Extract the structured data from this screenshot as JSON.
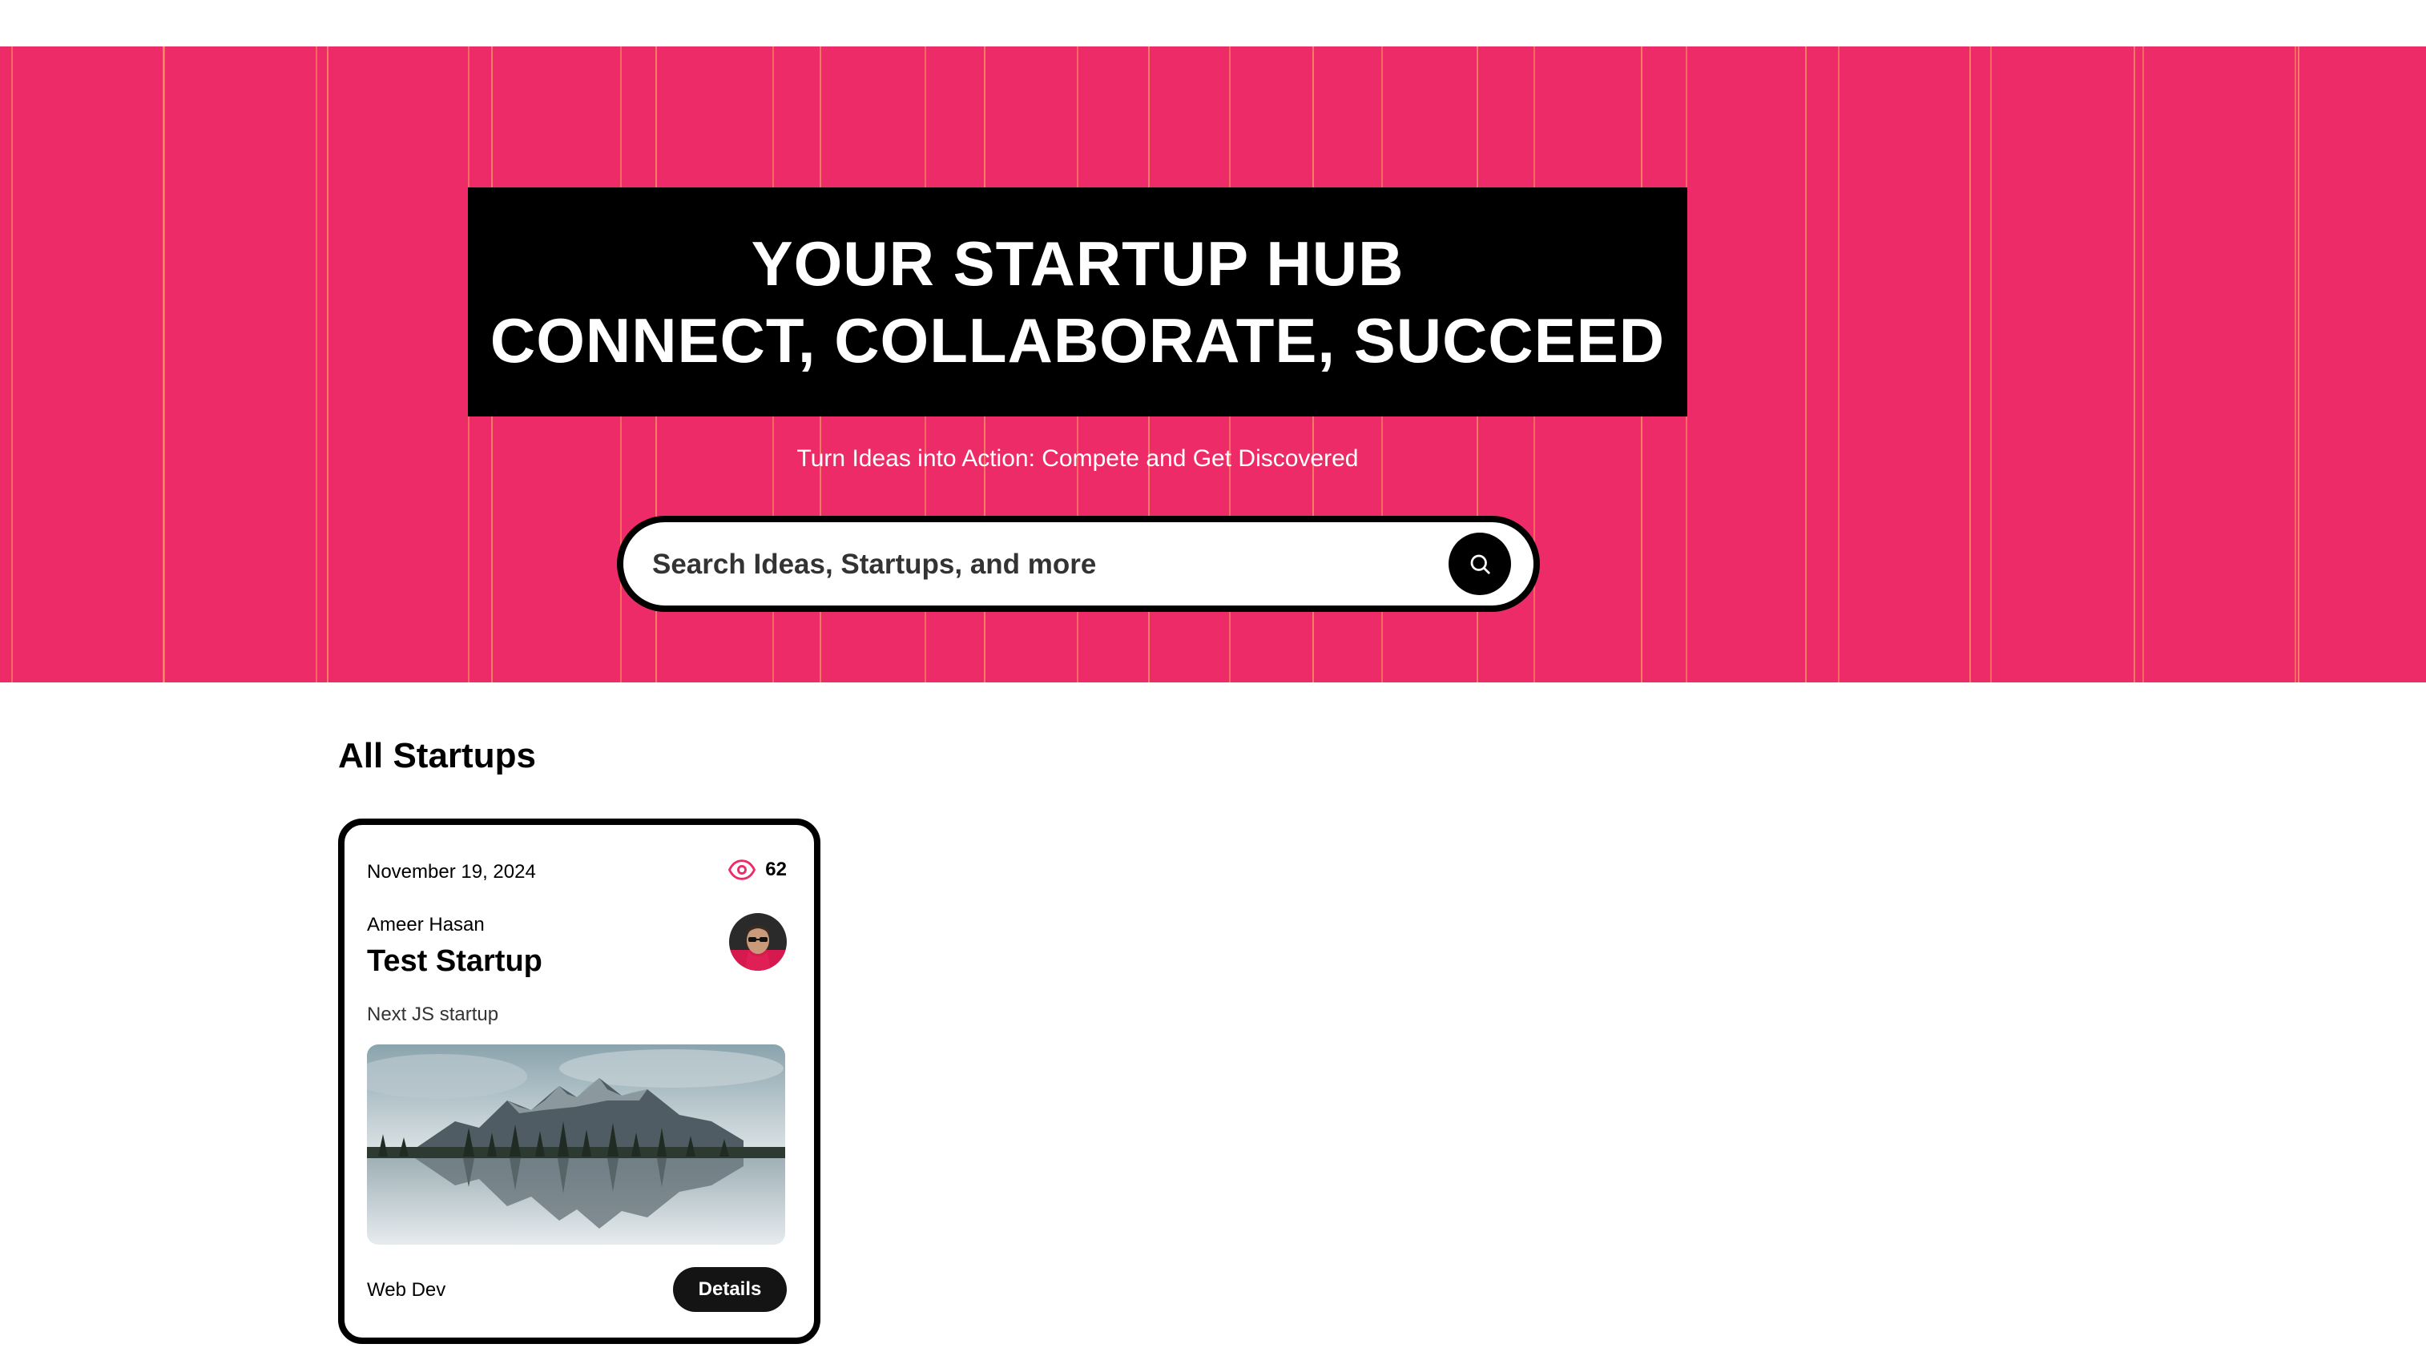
{
  "hero": {
    "heading_line1": "YOUR STARTUP HUB",
    "heading_line2": "CONNECT, COLLABORATE, SUCCEED",
    "subheading": "Turn Ideas into Action: Compete and Get Discovered",
    "background_color": "#ee2b69"
  },
  "search": {
    "placeholder": "Search Ideas, Startups, and more",
    "button_icon": "search-icon"
  },
  "section": {
    "title": "All Startups"
  },
  "startups": [
    {
      "date": "November 19, 2024",
      "views": "62",
      "views_icon": "eye-icon",
      "author": "Ameer Hasan",
      "title": "Test Startup",
      "description": "Next JS startup",
      "category": "Web Dev",
      "details_label": "Details"
    }
  ],
  "colors": {
    "accent": "#ee2b69",
    "dark": "#000000"
  }
}
